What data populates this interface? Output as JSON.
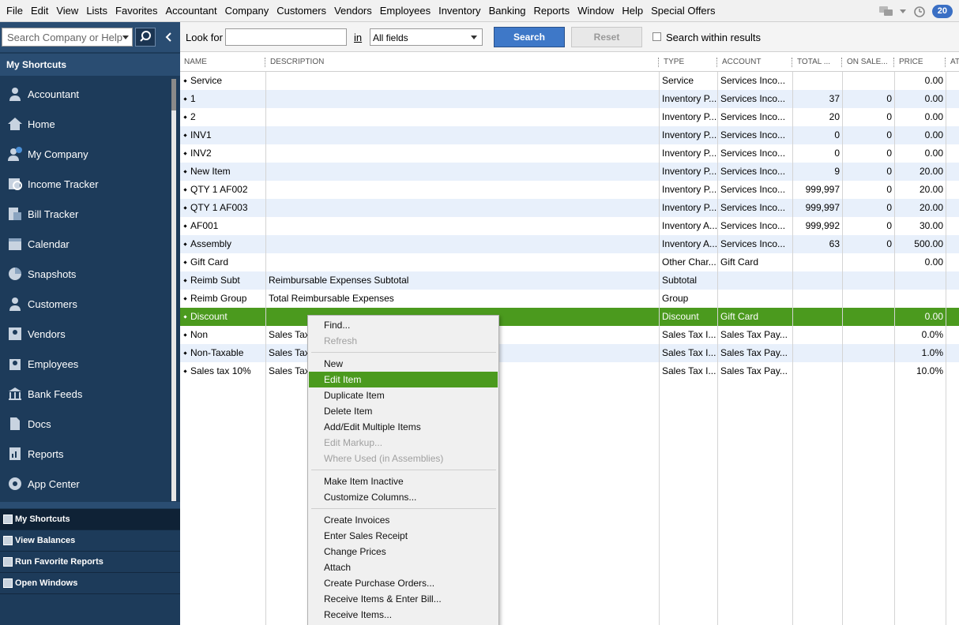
{
  "menu": [
    "File",
    "Edit",
    "View",
    "Lists",
    "Favorites",
    "Accountant",
    "Company",
    "Customers",
    "Vendors",
    "Employees",
    "Inventory",
    "Banking",
    "Reports",
    "Window",
    "Help",
    "Special Offers"
  ],
  "notifications": {
    "count": "20"
  },
  "sidebar": {
    "search_placeholder": "Search Company or Help",
    "header": "My Shortcuts",
    "items": [
      {
        "label": "Accountant",
        "icon": "accountant-icon"
      },
      {
        "label": "Home",
        "icon": "home-icon"
      },
      {
        "label": "My Company",
        "icon": "my-company-icon"
      },
      {
        "label": "Income Tracker",
        "icon": "income-tracker-icon"
      },
      {
        "label": "Bill Tracker",
        "icon": "bill-tracker-icon"
      },
      {
        "label": "Calendar",
        "icon": "calendar-icon"
      },
      {
        "label": "Snapshots",
        "icon": "snapshots-icon"
      },
      {
        "label": "Customers",
        "icon": "customers-icon"
      },
      {
        "label": "Vendors",
        "icon": "vendors-icon"
      },
      {
        "label": "Employees",
        "icon": "employees-icon"
      },
      {
        "label": "Bank Feeds",
        "icon": "bank-feeds-icon"
      },
      {
        "label": "Docs",
        "icon": "docs-icon"
      },
      {
        "label": "Reports",
        "icon": "reports-icon"
      },
      {
        "label": "App Center",
        "icon": "app-center-icon"
      }
    ],
    "bottom_tabs": [
      "My Shortcuts",
      "View Balances",
      "Run Favorite Reports",
      "Open Windows"
    ]
  },
  "search_bar": {
    "look_for_label": "Look for",
    "in_label": "in",
    "field_value": "All fields",
    "search_button": "Search",
    "reset_button": "Reset",
    "within_results_label": "Search within results"
  },
  "table": {
    "columns": [
      "NAME",
      "DESCRIPTION",
      "TYPE",
      "ACCOUNT",
      "TOTAL ...",
      "ON SALE...",
      "PRICE",
      "AT"
    ],
    "rows": [
      [
        "Service",
        "",
        "Service",
        "Services Inco...",
        "",
        "",
        "0.00"
      ],
      [
        "1",
        "",
        "Inventory P...",
        "Services Inco...",
        "37",
        "0",
        "0.00"
      ],
      [
        "2",
        "",
        "Inventory P...",
        "Services Inco...",
        "20",
        "0",
        "0.00"
      ],
      [
        "INV1",
        "",
        "Inventory P...",
        "Services Inco...",
        "0",
        "0",
        "0.00"
      ],
      [
        "INV2",
        "",
        "Inventory P...",
        "Services Inco...",
        "0",
        "0",
        "0.00"
      ],
      [
        "New Item",
        "",
        "Inventory P...",
        "Services Inco...",
        "9",
        "0",
        "20.00"
      ],
      [
        "QTY 1 AF002",
        "",
        "Inventory P...",
        "Services Inco...",
        "999,997",
        "0",
        "20.00"
      ],
      [
        "QTY 1 AF003",
        "",
        "Inventory P...",
        "Services Inco...",
        "999,997",
        "0",
        "20.00"
      ],
      [
        "AF001",
        "",
        "Inventory A...",
        "Services Inco...",
        "999,992",
        "0",
        "30.00"
      ],
      [
        "Assembly",
        "",
        "Inventory A...",
        "Services Inco...",
        "63",
        "0",
        "500.00"
      ],
      [
        "Gift Card",
        "",
        "Other Char...",
        "Gift Card",
        "",
        "",
        "0.00"
      ],
      [
        "Reimb Subt",
        "Reimbursable Expenses Subtotal",
        "Subtotal",
        "",
        "",
        "",
        ""
      ],
      [
        "Reimb Group",
        "Total Reimbursable Expenses",
        "Group",
        "",
        "",
        "",
        ""
      ],
      [
        "Discount",
        "",
        "Discount",
        "Gift Card",
        "",
        "",
        "0.00"
      ],
      [
        "Non",
        "Sales Tax",
        "Sales Tax I...",
        "Sales Tax Pay...",
        "",
        "",
        "0.0%"
      ],
      [
        "Non-Taxable",
        "Sales Tax",
        "Sales Tax I...",
        "Sales Tax Pay...",
        "",
        "",
        "1.0%"
      ],
      [
        "Sales tax 10%",
        "Sales Tax",
        "Sales Tax I...",
        "Sales Tax Pay...",
        "",
        "",
        "10.0%"
      ]
    ],
    "selected_row": 13
  },
  "context_menu": {
    "groups": [
      [
        {
          "label": "Find...",
          "enabled": true
        },
        {
          "label": "Refresh",
          "enabled": false
        }
      ],
      [
        {
          "label": "New",
          "enabled": true
        },
        {
          "label": "Edit Item",
          "enabled": true,
          "highlighted": true
        },
        {
          "label": "Duplicate Item",
          "enabled": true
        },
        {
          "label": "Delete Item",
          "enabled": true
        },
        {
          "label": "Add/Edit Multiple Items",
          "enabled": true
        },
        {
          "label": "Edit Markup...",
          "enabled": false
        },
        {
          "label": "Where Used (in Assemblies)",
          "enabled": false
        }
      ],
      [
        {
          "label": "Make Item Inactive",
          "enabled": true
        },
        {
          "label": "Customize Columns...",
          "enabled": true
        }
      ],
      [
        {
          "label": "Create Invoices",
          "enabled": true
        },
        {
          "label": "Enter Sales Receipt",
          "enabled": true
        },
        {
          "label": "Change Prices",
          "enabled": true
        },
        {
          "label": "Attach",
          "enabled": true
        },
        {
          "label": "Create Purchase Orders...",
          "enabled": true
        },
        {
          "label": "Receive Items & Enter Bill...",
          "enabled": true
        },
        {
          "label": "Receive Items...",
          "enabled": true
        }
      ]
    ]
  }
}
